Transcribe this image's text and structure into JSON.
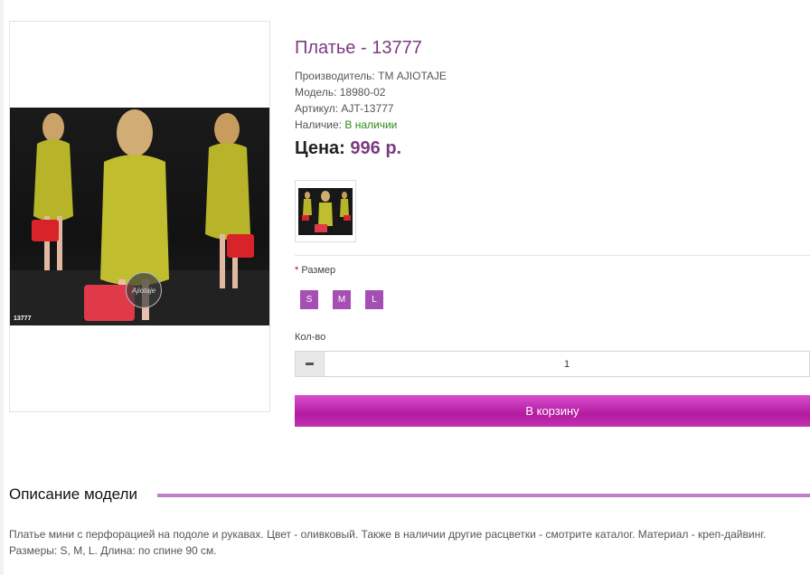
{
  "product": {
    "title": "Платье - 13777",
    "manufacturer_label": "Производитель:",
    "manufacturer": "ТМ AJIOTAJE",
    "model_label": "Модель:",
    "model": "18980-02",
    "sku_label": "Артикул:",
    "sku": "AJT-13777",
    "availability_label": "Наличие:",
    "availability": "В наличии",
    "price_label": "Цена:",
    "price": "996 р.",
    "photo_sku_tag": "13777",
    "photo_logo": "Ajiotaje"
  },
  "options": {
    "size_required_mark": "*",
    "size_label": "Размер",
    "sizes": [
      "S",
      "M",
      "L"
    ]
  },
  "quantity": {
    "label": "Кол-во",
    "value": "1"
  },
  "cart": {
    "button_label": "В корзину"
  },
  "description": {
    "heading": "Описание модели",
    "text": "Платье мини с перфорацией на подоле и рукавах. Цвет - оливковый. Также в наличии другие расцветки - смотрите каталог. Материал - креп-дайвинг. Размеры: S, M, L. Длина: по спине 90 см."
  },
  "colors": {
    "accent": "#7b3b80",
    "button": "#b41b9f",
    "size_button": "#a54fb4",
    "in_stock": "#2d8a1a"
  }
}
